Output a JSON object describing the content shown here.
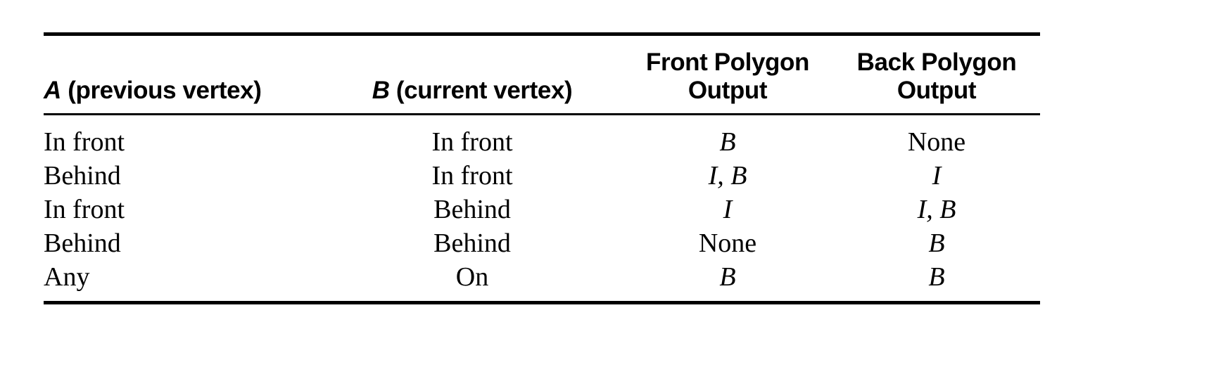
{
  "table": {
    "columns": [
      {
        "key": "a",
        "label_prefix": "A",
        "label_rest": " (previous vertex)",
        "align": "left"
      },
      {
        "key": "b",
        "label_prefix": "B",
        "label_rest": " (current vertex)",
        "align": "center"
      },
      {
        "key": "front",
        "line1": "Front Polygon",
        "line2": "Output",
        "align": "center"
      },
      {
        "key": "back",
        "line1": "Back Polygon",
        "line2": "Output",
        "align": "center"
      }
    ],
    "header": {
      "col_a_var": "A",
      "col_a_text": " (previous vertex)",
      "col_b_var": "B",
      "col_b_text": " (current vertex)",
      "col_front_line1": "Front Polygon",
      "col_front_line2": "Output",
      "col_back_line1": "Back Polygon",
      "col_back_line2": "Output"
    },
    "rows": [
      {
        "a": "In front",
        "b": "In front",
        "front": "B",
        "front_italic": true,
        "back": "None",
        "back_italic": false
      },
      {
        "a": "Behind",
        "b": "In front",
        "front": "I, B",
        "front_italic": true,
        "back": "I",
        "back_italic": true
      },
      {
        "a": "In front",
        "b": "Behind",
        "front": "I",
        "front_italic": true,
        "back": "I, B",
        "back_italic": true
      },
      {
        "a": "Behind",
        "b": "Behind",
        "front": "None",
        "front_italic": false,
        "back": "B",
        "back_italic": true
      },
      {
        "a": "Any",
        "b": "On",
        "front": "B",
        "front_italic": true,
        "back": "B",
        "back_italic": true
      }
    ],
    "rules": {
      "top_color": "#000000",
      "mid_color": "#000000",
      "bottom_color": "#000000"
    }
  }
}
